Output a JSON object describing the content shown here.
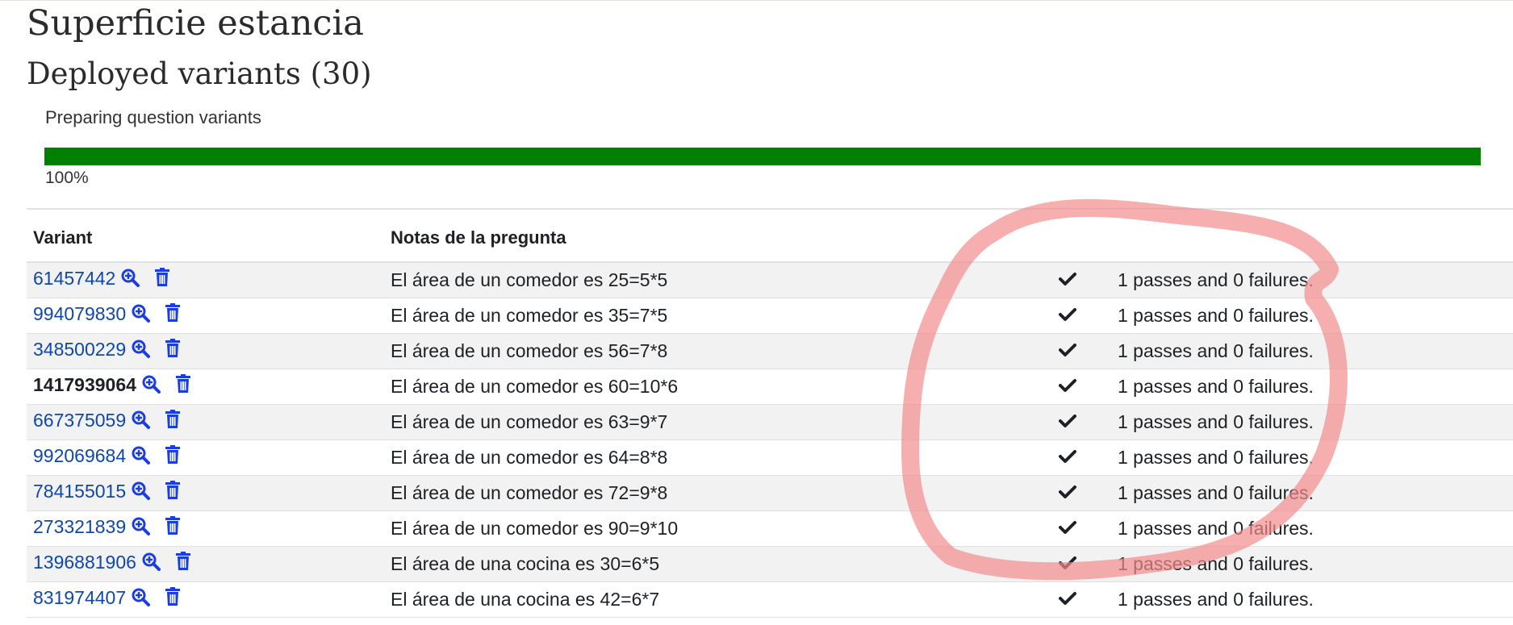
{
  "page_title": "Superficie estancia",
  "section_title": "Deployed variants (30)",
  "progress": {
    "label": "Preparing question variants",
    "percent_text": "100%",
    "value": 1.0,
    "bar_color": "#008000"
  },
  "table": {
    "headers": {
      "variant": "Variant",
      "notes": "Notas de la pregunta",
      "check": "",
      "result": ""
    },
    "rows": [
      {
        "variant": "61457442",
        "current": false,
        "notes": "El área de un comedor es 25=5*5",
        "result": "1 passes and 0 failures."
      },
      {
        "variant": "994079830",
        "current": false,
        "notes": "El área de un comedor es 35=7*5",
        "result": "1 passes and 0 failures."
      },
      {
        "variant": "348500229",
        "current": false,
        "notes": "El área de un comedor es 56=7*8",
        "result": "1 passes and 0 failures."
      },
      {
        "variant": "1417939064",
        "current": true,
        "notes": "El área de un comedor es 60=10*6",
        "result": "1 passes and 0 failures."
      },
      {
        "variant": "667375059",
        "current": false,
        "notes": "El área de un comedor es 63=9*7",
        "result": "1 passes and 0 failures."
      },
      {
        "variant": "992069684",
        "current": false,
        "notes": "El área de un comedor es 64=8*8",
        "result": "1 passes and 0 failures."
      },
      {
        "variant": "784155015",
        "current": false,
        "notes": "El área de un comedor es 72=9*8",
        "result": "1 passes and 0 failures."
      },
      {
        "variant": "273321839",
        "current": false,
        "notes": "El área de un comedor es 90=9*10",
        "result": "1 passes and 0 failures."
      },
      {
        "variant": "1396881906",
        "current": false,
        "notes": "El área de una cocina es 30=6*5",
        "result": "1 passes and 0 failures."
      },
      {
        "variant": "831974407",
        "current": false,
        "notes": "El área de una cocina es 42=6*7",
        "result": "1 passes and 0 failures."
      }
    ]
  },
  "icons": {
    "preview": "magnifier-plus-icon",
    "delete": "trash-icon",
    "status": "check-icon"
  },
  "colors": {
    "link": "#0f47ad",
    "icon": "#1a3de0",
    "annotation": "#f28b8b"
  }
}
